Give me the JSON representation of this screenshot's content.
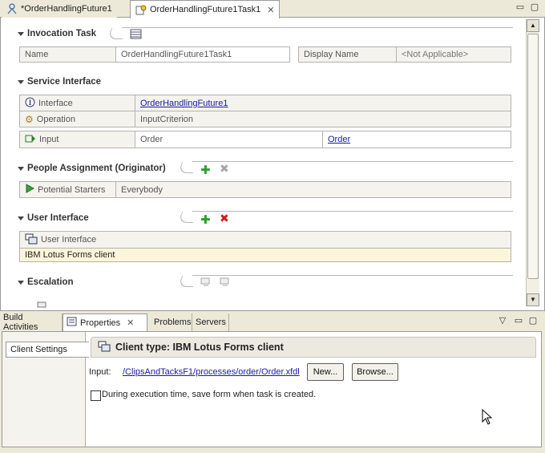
{
  "editor": {
    "tabs": [
      {
        "label": "*OrderHandlingFuture1",
        "active": false
      },
      {
        "label": "OrderHandlingFuture1Task1",
        "active": true
      }
    ]
  },
  "sections": {
    "invocation": {
      "title": "Invocation Task",
      "name_label": "Name",
      "name_value": "OrderHandlingFuture1Task1",
      "display_label": "Display Name",
      "display_value": "<Not Applicable>"
    },
    "service": {
      "title": "Service Interface",
      "interface_label": "Interface",
      "interface_value": "OrderHandlingFuture1",
      "operation_label": "Operation",
      "operation_value": "InputCriterion",
      "input_label": "Input",
      "input_value": "Order",
      "input_link": "Order"
    },
    "people": {
      "title": "People Assignment (Originator)",
      "row_label": "Potential Starters",
      "row_value": "Everybody"
    },
    "ui": {
      "title": "User Interface",
      "header": "User Interface",
      "row": "IBM Lotus Forms client"
    },
    "escalation": {
      "title": "Escalation"
    }
  },
  "view": {
    "tabs": [
      "Build Activities",
      "Properties",
      "Problems",
      "Servers"
    ],
    "side_item": "Client Settings",
    "panel_title": "Client type: IBM Lotus Forms client",
    "input_label": "Input:",
    "input_path": "/ClipsAndTacksF1/processes/order/Order.xfdl",
    "new_button": "New...",
    "browse_button": "Browse...",
    "checkbox_label": "During execution time, save form when task is created.",
    "checkbox_checked": false
  },
  "colors": {
    "link": "#1a1aa8",
    "highlight_row": "#fdf5d9",
    "add_green": "#2e9e2e",
    "delete_red": "#d41c1c"
  }
}
